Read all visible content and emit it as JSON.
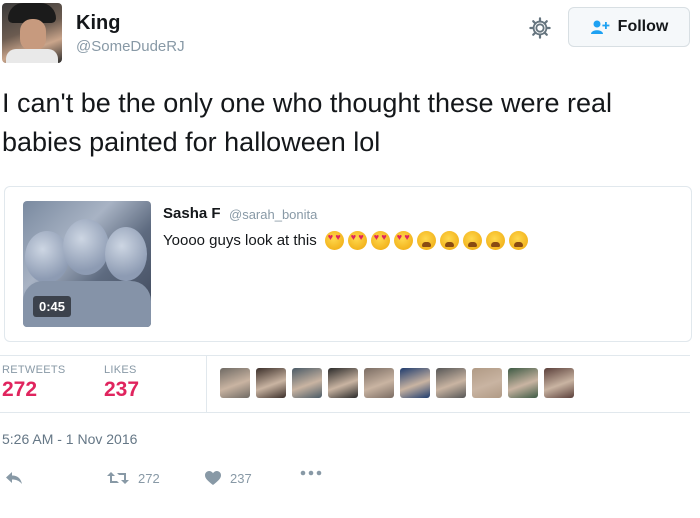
{
  "author": {
    "name": "King",
    "handle": "@SomeDudeRJ"
  },
  "follow_label": "Follow",
  "tweet_text": "I can't be the only one who thought these were real babies painted for halloween lol",
  "quoted": {
    "name": "Sasha F",
    "handle": "@sarah_bonita",
    "text": "Yoooo guys look at this",
    "emojis": [
      "heart-eyes",
      "heart-eyes",
      "heart-eyes",
      "heart-eyes",
      "weary",
      "weary",
      "weary",
      "weary",
      "weary"
    ],
    "video_duration": "0:45"
  },
  "stats": {
    "retweets_label": "RETWEETS",
    "retweets": "272",
    "likes_label": "LIKES",
    "likes": "237"
  },
  "likers": [
    {
      "color": "#6f6a64"
    },
    {
      "color": "#3b2f2a"
    },
    {
      "color": "#4a5a66"
    },
    {
      "color": "#2a2a2a"
    },
    {
      "color": "#7a6c63"
    },
    {
      "color": "#1f3c6e"
    },
    {
      "color": "#565656"
    },
    {
      "color": "#b09a85"
    },
    {
      "color": "#3d5a44"
    },
    {
      "color": "#5a3f3a"
    }
  ],
  "timestamp": "5:26 AM - 1 Nov 2016",
  "actions": {
    "retweet_count": "272",
    "like_count": "237"
  },
  "colors": {
    "accent": "#e0245e",
    "muted": "#8899a6",
    "border": "#e1e8ed",
    "follow_icon": "#1da1f2"
  }
}
